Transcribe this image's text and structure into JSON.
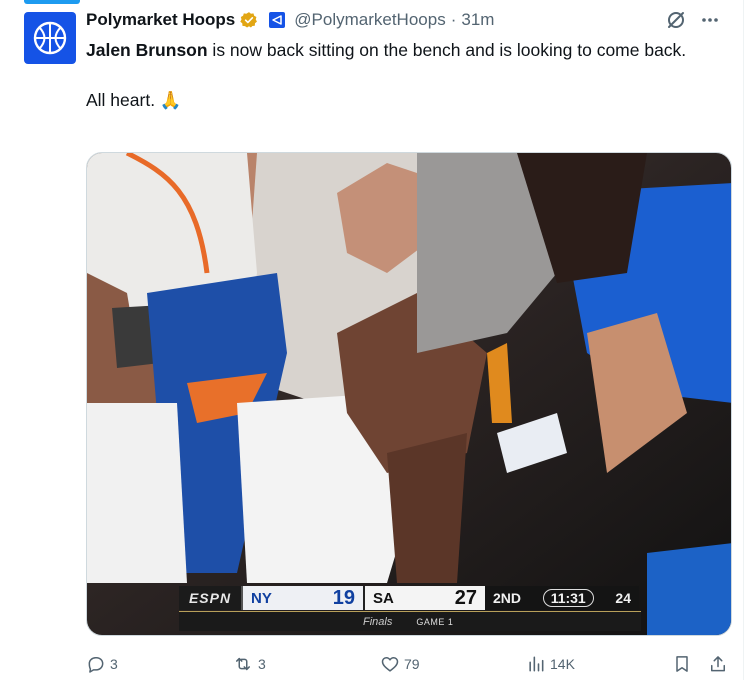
{
  "author": {
    "display_name": "Polymarket Hoops",
    "handle": "@PolymarketHoops",
    "separator": "·",
    "timestamp": "31m"
  },
  "tweet": {
    "mention": "Jalen Brunson",
    "body_rest": " is now back sitting on the bench and is looking to come back.",
    "line2": "All heart. 🙏"
  },
  "scoreboard": {
    "network": "ESPN",
    "team1": "NY",
    "score1": "19",
    "team2": "SA",
    "score2": "27",
    "quarter": "2ND",
    "clock": "11:31",
    "shot_clock": "24",
    "event": "Finals",
    "game": "GAME 1"
  },
  "actions": {
    "replies": "3",
    "reposts": "3",
    "likes": "79",
    "views": "14K"
  },
  "colors": {
    "accent": "#1d9bf0",
    "avatar_bg": "#1553e6",
    "secondary_text": "#536471"
  }
}
